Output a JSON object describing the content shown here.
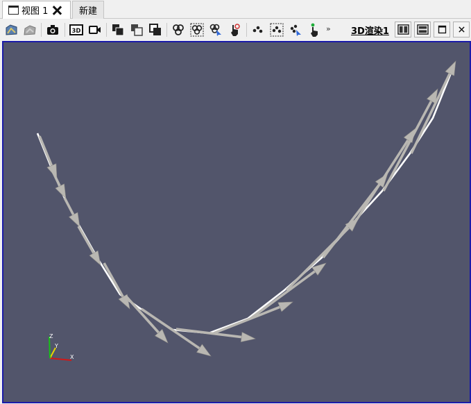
{
  "tabs": {
    "active_label": "视图 1",
    "new_label": "新建"
  },
  "toolbar": {
    "overflow_label": "»",
    "view_name": "3D渲染1",
    "buttons": [
      "reset-camera-icon",
      "redo-camera-icon",
      "screenshot-icon",
      "3d-toggle-icon",
      "record-icon",
      "show-selection-icon",
      "interactive-select-icon",
      "hide-selection-icon",
      "select-cells-on-icon",
      "select-cells-frustum-icon",
      "select-cells-polygon-icon",
      "hover-cells-icon",
      "select-points-on-icon",
      "select-points-frustum-icon",
      "select-points-polygon-icon",
      "hover-points-icon"
    ],
    "window_buttons": [
      "split-horizontal-icon",
      "split-vertical-icon",
      "maximize-icon",
      "close-icon"
    ]
  },
  "viewport": {
    "background": "#52556b",
    "border_color": "#1a1aa8",
    "glyph_color": "#b9b7b2",
    "line_color": "#ffffff"
  },
  "axes": {
    "x_label": "X",
    "y_label": "Y",
    "z_label": "Z",
    "x_color": "#d01818",
    "y_color": "#e8d600",
    "z_color": "#18c018"
  }
}
